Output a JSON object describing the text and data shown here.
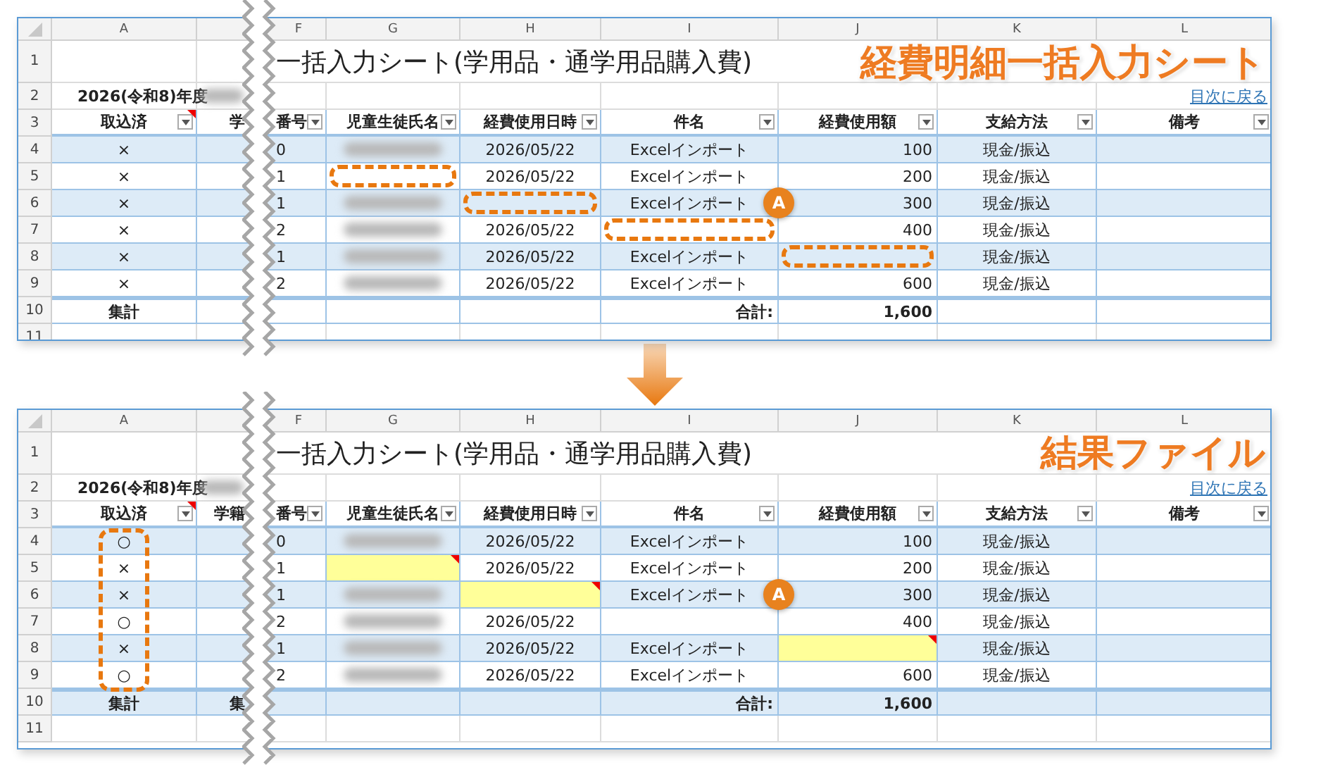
{
  "sheets": [
    {
      "caption": "経費明細一括入力シート",
      "column_letters": [
        "A",
        "F",
        "G",
        "H",
        "I",
        "J",
        "K",
        "L"
      ],
      "row_numbers": [
        "1",
        "2",
        "3",
        "4",
        "5",
        "6",
        "7",
        "8",
        "9",
        "10",
        "11"
      ],
      "title": "一括入力シート(学用品・通学用品購入費)",
      "fiscal_year": "2026(令和8)年度",
      "school_redacted": true,
      "toc_link": "目次に戻る",
      "headers": [
        {
          "text": "取込済",
          "flag": true
        },
        {
          "before_break": "学",
          "text": "番号"
        },
        {
          "text": "児童生徒氏名"
        },
        {
          "text": "経費使用日時"
        },
        {
          "text": "件名"
        },
        {
          "text": "経費使用額"
        },
        {
          "text": "支給方法"
        },
        {
          "text": "備考"
        }
      ],
      "rows": [
        [
          {
            "text": "×"
          },
          {
            "text": "0"
          },
          {
            "kind": "redacted"
          },
          {
            "text": "2026/05/22"
          },
          {
            "text": "Excelインポート"
          },
          {
            "text": "100"
          },
          {
            "text": "現金/振込"
          }
        ],
        [
          {
            "text": "×"
          },
          {
            "text": "1"
          },
          {
            "outlined": true
          },
          {
            "text": "2026/05/22"
          },
          {
            "text": "Excelインポート"
          },
          {
            "text": "200"
          },
          {
            "text": "現金/振込"
          }
        ],
        [
          {
            "text": "×"
          },
          {
            "text": "1"
          },
          {
            "kind": "redacted"
          },
          {
            "outlined": true
          },
          {
            "text": "Excelインポート",
            "callout": "A"
          },
          {
            "text": "300"
          },
          {
            "text": "現金/振込"
          }
        ],
        [
          {
            "text": "×"
          },
          {
            "text": "2"
          },
          {
            "kind": "redacted"
          },
          {
            "text": "2026/05/22"
          },
          {
            "outlined": true
          },
          {
            "text": "400"
          },
          {
            "text": "現金/振込"
          }
        ],
        [
          {
            "text": "×"
          },
          {
            "text": "1"
          },
          {
            "kind": "redacted"
          },
          {
            "text": "2026/05/22"
          },
          {
            "text": "Excelインポート"
          },
          {
            "outlined": true
          },
          {
            "text": "現金/振込"
          }
        ],
        [
          {
            "text": "×"
          },
          {
            "text": "2"
          },
          {
            "kind": "redacted"
          },
          {
            "text": "2026/05/22"
          },
          {
            "text": "Excelインポート"
          },
          {
            "text": "600"
          },
          {
            "text": "現金/振込"
          }
        ]
      ],
      "total_row": {
        "shaded": false,
        "label": "集計",
        "sum_label": "合計:",
        "sum": "1,600"
      }
    },
    {
      "caption": "結果ファイル",
      "column_letters": [
        "A",
        "F",
        "G",
        "H",
        "I",
        "J",
        "K",
        "L"
      ],
      "row_numbers": [
        "1",
        "2",
        "3",
        "4",
        "5",
        "6",
        "7",
        "8",
        "9",
        "10",
        "11"
      ],
      "title": "一括入力シート(学用品・通学用品購入費)",
      "fiscal_year": "2026(令和8)年度",
      "school_redacted": true,
      "toc_link": "目次に戻る",
      "headers": [
        {
          "text": "取込済",
          "flag": true
        },
        {
          "before_break": "学籍",
          "text": "番号"
        },
        {
          "text": "児童生徒氏名"
        },
        {
          "text": "経費使用日時"
        },
        {
          "text": "件名"
        },
        {
          "text": "経費使用額"
        },
        {
          "text": "支給方法"
        },
        {
          "text": "備考"
        }
      ],
      "rows": [
        [
          {
            "text": "○"
          },
          {
            "text": "0"
          },
          {
            "kind": "redacted"
          },
          {
            "text": "2026/05/22"
          },
          {
            "text": "Excelインポート"
          },
          {
            "text": "100"
          },
          {
            "text": "現金/振込"
          }
        ],
        [
          {
            "text": "×"
          },
          {
            "text": "1"
          },
          {
            "highlighted": true,
            "flag": true
          },
          {
            "text": "2026/05/22"
          },
          {
            "text": "Excelインポート"
          },
          {
            "text": "200"
          },
          {
            "text": "現金/振込"
          }
        ],
        [
          {
            "text": "×"
          },
          {
            "text": "1"
          },
          {
            "kind": "redacted"
          },
          {
            "highlighted": true,
            "flag": true
          },
          {
            "text": "Excelインポート",
            "callout": "A"
          },
          {
            "text": "300"
          },
          {
            "text": "現金/振込"
          }
        ],
        [
          {
            "text": "○"
          },
          {
            "text": "2"
          },
          {
            "kind": "redacted"
          },
          {
            "text": "2026/05/22"
          },
          {},
          {
            "text": "400"
          },
          {
            "text": "現金/振込"
          }
        ],
        [
          {
            "text": "×"
          },
          {
            "text": "1"
          },
          {
            "kind": "redacted"
          },
          {
            "text": "2026/05/22"
          },
          {
            "text": "Excelインポート"
          },
          {
            "highlighted": true,
            "flag": true
          },
          {
            "text": "現金/振込"
          }
        ],
        [
          {
            "text": "○"
          },
          {
            "text": "2"
          },
          {
            "kind": "redacted"
          },
          {
            "text": "2026/05/22"
          },
          {
            "text": "Excelインポート"
          },
          {
            "text": "600"
          },
          {
            "text": "現金/振込"
          }
        ]
      ],
      "total_row": {
        "shaded": true,
        "label": "集計",
        "label_before_break": "集",
        "sum_label": "合計:",
        "sum": "1,600"
      },
      "column_a_outlined": true
    }
  ]
}
